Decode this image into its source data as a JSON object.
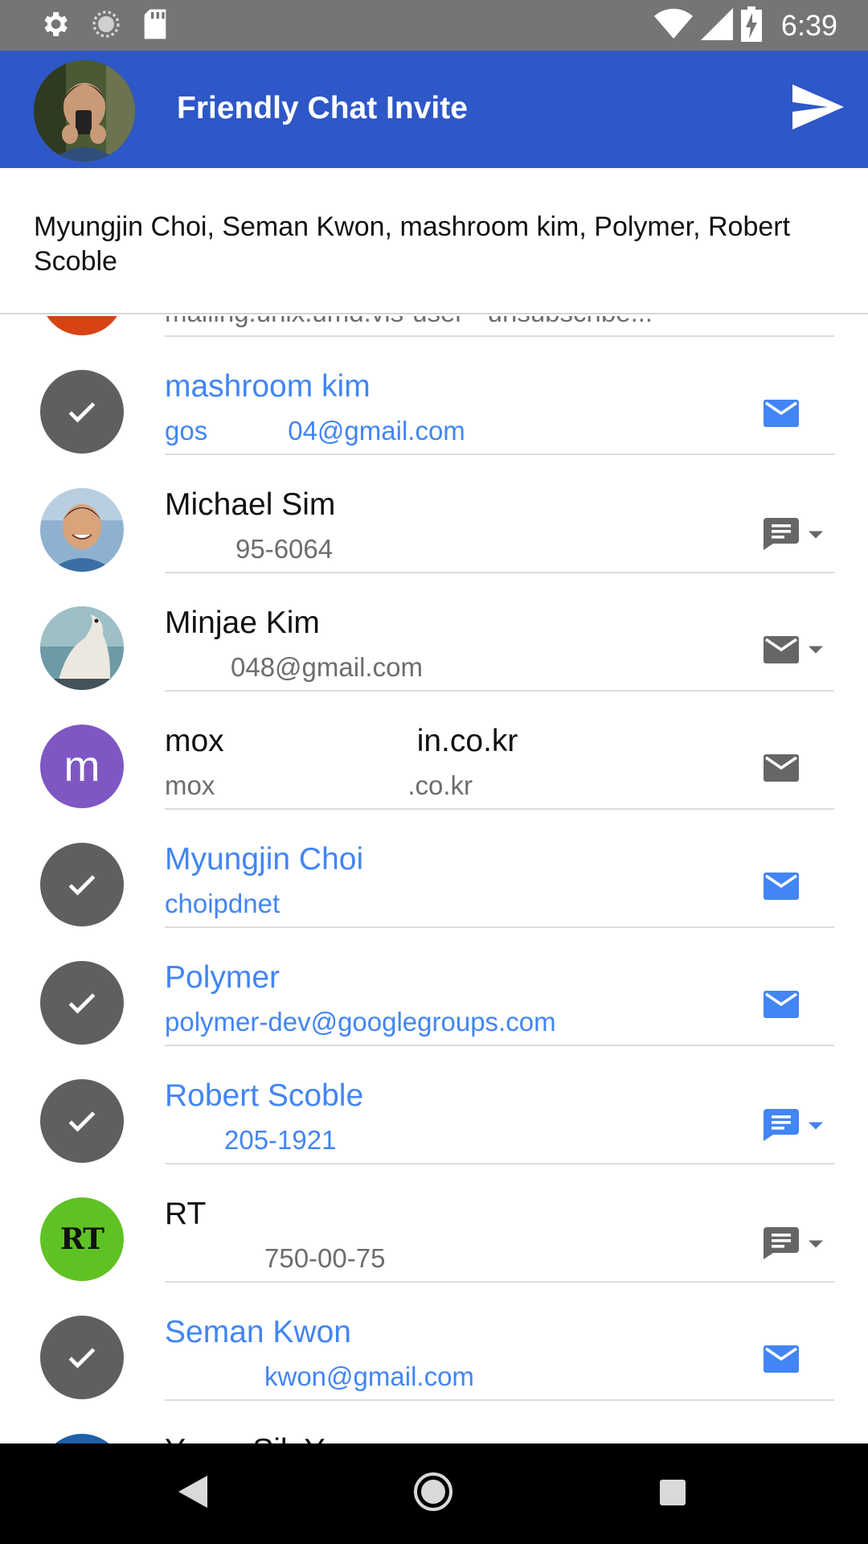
{
  "status_bar": {
    "time": "6:39",
    "left_icons": [
      "settings-icon",
      "sync-icon",
      "sd-card-icon"
    ],
    "right_icons": [
      "wifi-icon",
      "signal-icon",
      "battery-charging-icon"
    ]
  },
  "app_bar": {
    "title": "Friendly Chat Invite",
    "send_icon": "send-icon"
  },
  "recipients": {
    "text": "Myungjin Choi, Seman Kwon, mashroom kim, Polymer, Robert Scoble"
  },
  "partial_top_row": {
    "sub": "mailing.unix.umd.vis-user - unsubscribe..."
  },
  "contacts": [
    {
      "name": "mashroom kim",
      "sub_prefix": "gos",
      "sub_suffix": "04@gmail.com",
      "selected": true,
      "avatar": "check-icon",
      "action": "email-icon",
      "has_dropdown": false
    },
    {
      "name": "Michael Sim",
      "sub_prefix": "",
      "sub_suffix": "95-6064",
      "selected": false,
      "avatar": "photo-smiling-man",
      "action": "message-icon",
      "has_dropdown": true
    },
    {
      "name": "Minjae Kim",
      "sub_prefix": "",
      "sub_suffix": "048@gmail.com",
      "selected": false,
      "avatar": "photo-polar-bear",
      "action": "email-icon",
      "has_dropdown": true
    },
    {
      "name_prefix": "mox",
      "name_suffix": "in.co.kr",
      "sub_prefix": "mox",
      "sub_suffix": ".co.kr",
      "selected": false,
      "avatar": "m",
      "action": "email-icon",
      "has_dropdown": false
    },
    {
      "name": "Myungjin Choi",
      "sub_prefix": "choipdnet",
      "sub_suffix": "",
      "selected": true,
      "avatar": "check-icon",
      "action": "email-icon",
      "has_dropdown": false
    },
    {
      "name": "Polymer",
      "sub_prefix": "polymer-dev@googlegroups.com",
      "sub_suffix": "",
      "selected": true,
      "avatar": "check-icon",
      "action": "email-icon",
      "has_dropdown": false
    },
    {
      "name": "Robert Scoble",
      "sub_prefix": "",
      "sub_suffix": "205-1921",
      "selected": true,
      "avatar": "check-icon",
      "action": "message-icon",
      "has_dropdown": true
    },
    {
      "name": "RT",
      "sub_prefix": "",
      "sub_suffix": "750-00-75",
      "selected": false,
      "avatar": "RT",
      "action": "message-icon",
      "has_dropdown": true
    },
    {
      "name": "Seman Kwon",
      "sub_prefix": "",
      "sub_suffix": "kwon@gmail.com",
      "selected": true,
      "avatar": "check-icon",
      "action": "email-icon",
      "has_dropdown": false
    }
  ],
  "partial_bottom_row": {
    "name": "YoungSik Yun"
  },
  "nav_bar": {
    "icons": [
      "back-icon",
      "home-icon",
      "recents-icon"
    ]
  },
  "colors": {
    "app_bar": "#2e57c7",
    "status_bar": "#757575",
    "selected_text": "#4285f4",
    "check_avatar": "#5f5f5f",
    "letter_avatar": "#7e57c2",
    "rt_avatar": "#5fc224"
  }
}
